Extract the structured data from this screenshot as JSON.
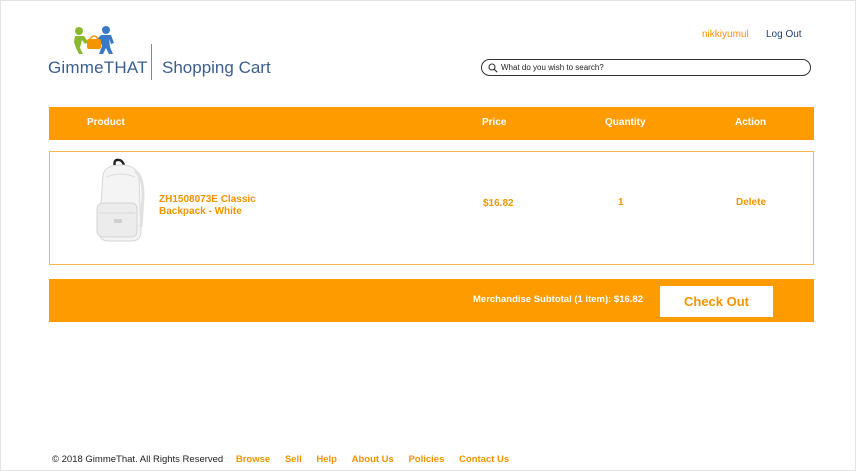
{
  "header": {
    "brand": "GimmeTHAT",
    "page_title": "Shopping Cart",
    "username": "nikkiyumul",
    "logout_label": "Log Out",
    "search": {
      "placeholder": "What do you wish to search?",
      "value": ""
    }
  },
  "table": {
    "columns": {
      "product": "Product",
      "price": "Price",
      "quantity": "Quantity",
      "action": "Action"
    },
    "rows": [
      {
        "product_name": "ZH1508073E Classic Backpack - White",
        "price": "$16.82",
        "quantity": "1",
        "action": "Delete"
      }
    ]
  },
  "summary": {
    "subtotal_text": "Merchandise Subtotal (1 item): $16.82",
    "checkout_label": "Check Out"
  },
  "footer": {
    "copyright": "© 2018 GimmeThat. All Rights Reserved",
    "links": [
      "Browse",
      "Sell",
      "Help",
      "About Us",
      "Policies",
      "Contact Us"
    ]
  },
  "colors": {
    "accent_orange": "#fe9b00",
    "link_orange": "#f39400",
    "brand_blue": "#3a5f8f",
    "nav_blue": "#1f3f6e"
  },
  "icons": {
    "logo": "people-carrying-bag-logo-icon",
    "search": "search-icon",
    "product": "backpack-image"
  }
}
